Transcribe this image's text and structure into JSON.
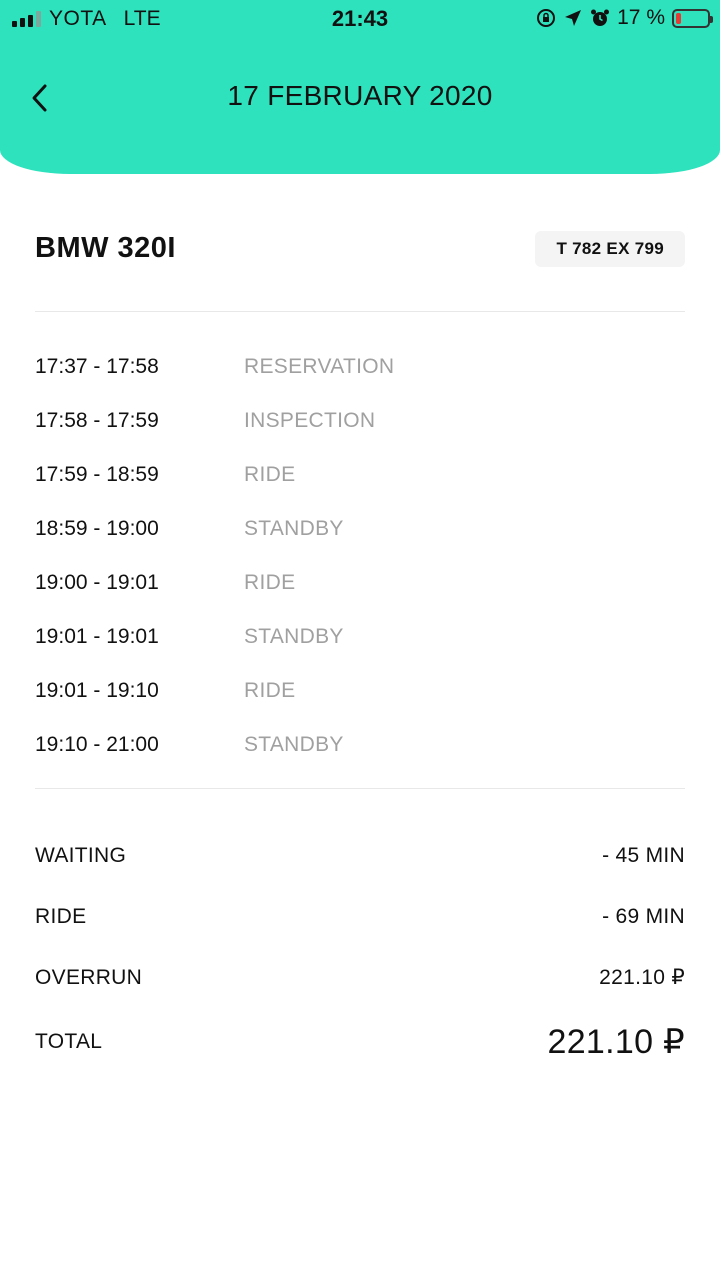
{
  "status_bar": {
    "carrier": "YOTA",
    "network": "LTE",
    "time": "21:43",
    "battery_percent": "17 %",
    "battery_level": 0.17
  },
  "header": {
    "title": "17 FEBRUARY 2020",
    "background_color": "#2de2bd"
  },
  "car": {
    "name": "BMW 320I",
    "plate": "T 782 EX  799"
  },
  "timeline": [
    {
      "time": "17:37 - 17:58",
      "status": "RESERVATION"
    },
    {
      "time": "17:58 - 17:59",
      "status": "INSPECTION"
    },
    {
      "time": "17:59 - 18:59",
      "status": "RIDE"
    },
    {
      "time": "18:59 - 19:00",
      "status": "STANDBY"
    },
    {
      "time": "19:00 - 19:01",
      "status": "RIDE"
    },
    {
      "time": "19:01 - 19:01",
      "status": "STANDBY"
    },
    {
      "time": "19:01 - 19:10",
      "status": "RIDE"
    },
    {
      "time": "19:10 - 21:00",
      "status": "STANDBY"
    }
  ],
  "summary": [
    {
      "label": "WAITING",
      "value": "- 45 MIN"
    },
    {
      "label": "RIDE",
      "value": "- 69 MIN"
    },
    {
      "label": "OVERRUN",
      "value": "221.10 ₽"
    }
  ],
  "total": {
    "label": "TOTAL",
    "value": "221.10 ₽"
  }
}
